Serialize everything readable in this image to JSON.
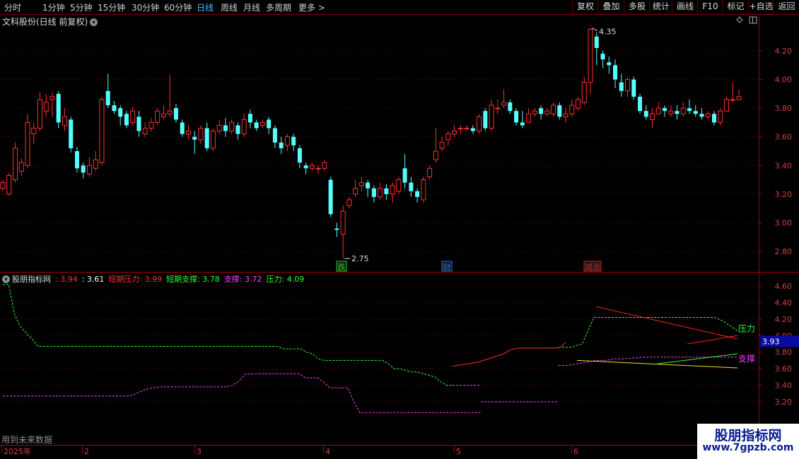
{
  "toolbar": {
    "timeframes": [
      "分时",
      "1分钟",
      "5分钟",
      "15分钟",
      "30分钟",
      "60分钟",
      "日线",
      "周线",
      "月线",
      "多周期",
      "更多 >"
    ],
    "active_timeframe": "日线",
    "buttons": [
      "复权",
      "叠加",
      "多股",
      "统计",
      "画线",
      "F10",
      "标记",
      "+自选",
      "返回"
    ]
  },
  "main_chart": {
    "title": "文科股份(日线 前复权)",
    "high_label": "4.35",
    "low_label": "2.75",
    "price_ticks": [
      "4.20",
      "4.00",
      "3.80",
      "3.60",
      "3.40",
      "3.20",
      "3.00",
      "2.80"
    ],
    "event_markers": [
      {
        "text": "跌",
        "color": "#22cc22"
      },
      {
        "text": "财",
        "color": "#2266ff"
      },
      {
        "text": "涨",
        "color": "#cc2222",
        "prefix": "减"
      }
    ]
  },
  "indicator": {
    "name": "股朋指标网",
    "values": [
      {
        "label": "",
        "value": "3.94",
        "color": "#ff3030"
      },
      {
        "label": "",
        "value": "3.61",
        "color": "#ffffff"
      },
      {
        "label": "短期压力",
        "value": "3.99",
        "color": "#ff3030"
      },
      {
        "label": "短期支撑",
        "value": "3.78",
        "color": "#30ff30"
      },
      {
        "label": "支撑",
        "value": "3.72",
        "color": "#ff40ff"
      },
      {
        "label": "压力",
        "value": "4.09",
        "color": "#30ff30"
      }
    ],
    "ticks": [
      "4.60",
      "4.40",
      "4.20",
      "4.00",
      "3.80",
      "3.60",
      "3.40",
      "3.20"
    ],
    "current_value": "3.93",
    "label_resistance": "压力",
    "label_support": "支撑",
    "footer_note": "用到未来数据"
  },
  "date_axis": [
    "2025年",
    "2",
    "3",
    "4",
    "5",
    "6"
  ],
  "watermark": {
    "line1": "股朋指标网",
    "line2": "www.7gpzb.com"
  },
  "colors": {
    "up": "#ff3030",
    "down": "#54ffff",
    "grid": "#7a0000",
    "axis": "#a00000",
    "resistance": "#30ff30",
    "support": "#ff40ff"
  },
  "chart_data": {
    "type": "candlestick",
    "ylim": [
      2.75,
      4.35
    ],
    "candles": [
      [
        3.24,
        3.28,
        3.3,
        3.22
      ],
      [
        3.2,
        3.33,
        3.35,
        3.19
      ],
      [
        3.3,
        3.52,
        3.56,
        3.28
      ],
      [
        3.36,
        3.42,
        3.45,
        3.33
      ],
      [
        3.4,
        3.7,
        3.76,
        3.38
      ],
      [
        3.62,
        3.66,
        3.7,
        3.55
      ],
      [
        3.66,
        3.86,
        3.91,
        3.64
      ],
      [
        3.78,
        3.84,
        3.9,
        3.74
      ],
      [
        3.86,
        3.88,
        3.91,
        3.74
      ],
      [
        3.9,
        3.7,
        3.92,
        3.66
      ],
      [
        3.68,
        3.74,
        3.8,
        3.64
      ],
      [
        3.72,
        3.52,
        3.74,
        3.49
      ],
      [
        3.5,
        3.38,
        3.53,
        3.35
      ],
      [
        3.4,
        3.35,
        3.42,
        3.31
      ],
      [
        3.34,
        3.4,
        3.46,
        3.32
      ],
      [
        3.38,
        3.44,
        3.5,
        3.36
      ],
      [
        3.42,
        3.86,
        3.88,
        3.4
      ],
      [
        3.92,
        3.82,
        4.04,
        3.8
      ],
      [
        3.82,
        3.78,
        3.85,
        3.76
      ],
      [
        3.8,
        3.74,
        3.82,
        3.68
      ],
      [
        3.76,
        3.68,
        3.78,
        3.66
      ],
      [
        3.7,
        3.78,
        3.81,
        3.68
      ],
      [
        3.74,
        3.64,
        3.78,
        3.6
      ],
      [
        3.62,
        3.66,
        3.7,
        3.6
      ],
      [
        3.66,
        3.7,
        3.73,
        3.64
      ],
      [
        3.7,
        3.78,
        3.8,
        3.68
      ],
      [
        3.74,
        3.76,
        3.82,
        3.72
      ],
      [
        3.76,
        3.78,
        4.03,
        3.74
      ],
      [
        3.8,
        3.72,
        3.83,
        3.7
      ],
      [
        3.7,
        3.62,
        3.72,
        3.6
      ],
      [
        3.62,
        3.64,
        3.68,
        3.58
      ],
      [
        3.6,
        3.58,
        3.64,
        3.48
      ],
      [
        3.58,
        3.66,
        3.68,
        3.55
      ],
      [
        3.66,
        3.52,
        3.7,
        3.5
      ],
      [
        3.52,
        3.64,
        3.66,
        3.5
      ],
      [
        3.64,
        3.68,
        3.72,
        3.62
      ],
      [
        3.68,
        3.64,
        3.73,
        3.6
      ],
      [
        3.64,
        3.7,
        3.72,
        3.62
      ],
      [
        3.68,
        3.62,
        3.7,
        3.58
      ],
      [
        3.62,
        3.72,
        3.76,
        3.6
      ],
      [
        3.76,
        3.7,
        3.79,
        3.66
      ],
      [
        3.7,
        3.66,
        3.72,
        3.64
      ],
      [
        3.68,
        3.7,
        3.72,
        3.66
      ],
      [
        3.72,
        3.66,
        3.74,
        3.62
      ],
      [
        3.66,
        3.56,
        3.68,
        3.52
      ],
      [
        3.56,
        3.52,
        3.6,
        3.48
      ],
      [
        3.54,
        3.6,
        3.62,
        3.5
      ],
      [
        3.6,
        3.54,
        3.62,
        3.5
      ],
      [
        3.52,
        3.42,
        3.54,
        3.38
      ],
      [
        3.4,
        3.38,
        3.42,
        3.34
      ],
      [
        3.38,
        3.4,
        3.42,
        3.36
      ],
      [
        3.38,
        3.38,
        3.4,
        3.34
      ],
      [
        3.38,
        3.42,
        3.44,
        3.36
      ],
      [
        3.3,
        3.06,
        3.32,
        3.04
      ],
      [
        2.96,
        2.95,
        3.0,
        2.9
      ],
      [
        2.92,
        3.08,
        3.12,
        2.75
      ],
      [
        3.12,
        3.16,
        3.18,
        3.1
      ],
      [
        3.2,
        3.24,
        3.3,
        3.18
      ],
      [
        3.26,
        3.28,
        3.32,
        3.22
      ],
      [
        3.28,
        3.24,
        3.3,
        3.18
      ],
      [
        3.24,
        3.18,
        3.26,
        3.14
      ],
      [
        3.18,
        3.24,
        3.28,
        3.16
      ],
      [
        3.24,
        3.2,
        3.27,
        3.16
      ],
      [
        3.2,
        3.26,
        3.28,
        3.14
      ],
      [
        3.22,
        3.3,
        3.32,
        3.2
      ],
      [
        3.38,
        3.28,
        3.48,
        3.24
      ],
      [
        3.28,
        3.22,
        3.32,
        3.18
      ],
      [
        3.22,
        3.18,
        3.24,
        3.14
      ],
      [
        3.16,
        3.3,
        3.32,
        3.14
      ],
      [
        3.32,
        3.38,
        3.4,
        3.3
      ],
      [
        3.44,
        3.5,
        3.66,
        3.42
      ],
      [
        3.52,
        3.56,
        3.6,
        3.5
      ],
      [
        3.58,
        3.62,
        3.64,
        3.54
      ],
      [
        3.62,
        3.64,
        3.68,
        3.6
      ],
      [
        3.66,
        3.66,
        3.68,
        3.62
      ],
      [
        3.66,
        3.66,
        3.68,
        3.64
      ],
      [
        3.66,
        3.64,
        3.68,
        3.62
      ],
      [
        3.64,
        3.74,
        3.76,
        3.62
      ],
      [
        3.78,
        3.66,
        3.8,
        3.64
      ],
      [
        3.66,
        3.82,
        3.86,
        3.64
      ],
      [
        3.8,
        3.8,
        3.86,
        3.76
      ],
      [
        3.82,
        3.84,
        3.93,
        3.8
      ],
      [
        3.84,
        3.78,
        3.86,
        3.76
      ],
      [
        3.78,
        3.7,
        3.8,
        3.68
      ],
      [
        3.7,
        3.68,
        3.78,
        3.66
      ],
      [
        3.7,
        3.76,
        3.8,
        3.7
      ],
      [
        3.76,
        3.78,
        3.8,
        3.74
      ],
      [
        3.8,
        3.76,
        3.82,
        3.72
      ],
      [
        3.76,
        3.78,
        3.8,
        3.74
      ],
      [
        3.76,
        3.82,
        3.84,
        3.74
      ],
      [
        3.82,
        3.74,
        3.84,
        3.72
      ],
      [
        3.74,
        3.76,
        3.8,
        3.7
      ],
      [
        3.76,
        3.82,
        3.86,
        3.74
      ],
      [
        3.8,
        3.86,
        3.88,
        3.78
      ],
      [
        3.84,
        3.98,
        4.02,
        3.82
      ],
      [
        3.98,
        4.35,
        4.36,
        3.9
      ],
      [
        4.3,
        4.22,
        4.33,
        4.1
      ],
      [
        4.18,
        4.14,
        4.2,
        4.08
      ],
      [
        4.12,
        4.1,
        4.16,
        4.04
      ],
      [
        4.1,
        4.0,
        4.14,
        3.94
      ],
      [
        3.98,
        3.92,
        4.04,
        3.88
      ],
      [
        3.92,
        4.0,
        4.02,
        3.88
      ],
      [
        4.0,
        3.88,
        4.02,
        3.86
      ],
      [
        3.88,
        3.78,
        3.9,
        3.76
      ],
      [
        3.78,
        3.74,
        3.82,
        3.72
      ],
      [
        3.72,
        3.76,
        3.8,
        3.66
      ],
      [
        3.76,
        3.8,
        3.84,
        3.76
      ],
      [
        3.8,
        3.78,
        3.82,
        3.74
      ],
      [
        3.76,
        3.78,
        3.82,
        3.74
      ],
      [
        3.78,
        3.76,
        3.82,
        3.72
      ],
      [
        3.76,
        3.8,
        3.84,
        3.74
      ],
      [
        3.8,
        3.78,
        3.86,
        3.76
      ],
      [
        3.78,
        3.76,
        3.82,
        3.74
      ],
      [
        3.76,
        3.74,
        3.8,
        3.72
      ],
      [
        3.74,
        3.76,
        3.78,
        3.72
      ],
      [
        3.76,
        3.7,
        3.78,
        3.68
      ],
      [
        3.7,
        3.78,
        3.8,
        3.68
      ],
      [
        3.78,
        3.86,
        3.88,
        3.78
      ],
      [
        3.86,
        3.86,
        3.98,
        3.84
      ],
      [
        3.86,
        3.88,
        3.93,
        3.86
      ]
    ],
    "indicator_series": {
      "resistance_dashed": [
        4.62,
        4.62,
        4.26,
        4.11,
        4.03,
        3.96,
        3.87,
        3.87,
        3.87,
        3.87,
        3.87,
        3.87,
        3.87,
        3.87,
        3.87,
        3.87,
        3.87,
        3.87,
        3.87,
        3.87,
        3.87,
        3.87,
        3.87,
        3.87,
        3.87,
        3.87,
        3.87,
        3.87,
        3.87,
        3.87,
        3.87,
        3.87,
        3.87,
        3.87,
        3.87,
        3.87,
        3.87,
        3.87,
        3.87,
        3.87,
        3.87,
        3.87,
        3.87,
        3.87,
        3.87,
        3.87,
        3.87,
        3.87,
        3.84,
        3.84,
        3.84,
        3.84,
        3.8,
        3.78,
        3.72,
        3.7,
        3.7,
        3.7,
        3.7,
        3.7,
        3.7,
        3.7,
        3.7,
        3.7,
        3.7,
        3.7,
        3.66,
        3.6,
        3.6,
        3.58,
        3.56,
        3.56,
        3.54,
        3.52,
        3.5,
        3.44,
        3.4,
        3.4
      ],
      "support_dashed": [
        3.27,
        3.27,
        3.27,
        3.27,
        3.27,
        3.27,
        3.27,
        3.27,
        3.27,
        3.27,
        3.27,
        3.27,
        3.27,
        3.27,
        3.27,
        3.27,
        3.27,
        3.27,
        3.27,
        3.27,
        3.27,
        3.27,
        3.3,
        3.33,
        3.36,
        3.37,
        3.38,
        3.38,
        3.38,
        3.38,
        3.38,
        3.38,
        3.38,
        3.38,
        3.38,
        3.38,
        3.38,
        3.38,
        3.4,
        3.45,
        3.53,
        3.54,
        3.54,
        3.54,
        3.54,
        3.54,
        3.54,
        3.54,
        3.54,
        3.54,
        3.49,
        3.49,
        3.49,
        3.44,
        3.37,
        3.37,
        3.37,
        3.37,
        3.2,
        3.07,
        3.07,
        3.07,
        3.07,
        3.07,
        3.07,
        3.07,
        3.07,
        3.07,
        3.07,
        3.07,
        3.07,
        3.07,
        3.07,
        3.07,
        3.07,
        3.07,
        3.07,
        3.07,
        3.07,
        3.07
      ],
      "right_resistance_dashed": [
        4.22,
        4.22,
        4.22,
        4.22,
        4.22,
        4.22,
        4.22,
        4.22,
        4.22,
        4.22,
        4.22,
        4.22,
        4.22,
        4.22,
        4.22,
        4.22,
        4.22,
        4.18,
        4.12,
        4.06
      ],
      "right_support_dashed": [
        3.64,
        3.64,
        3.66,
        3.68,
        3.7,
        3.7,
        3.72,
        3.72,
        3.73,
        3.74,
        3.74,
        3.74,
        3.74,
        3.74,
        3.74,
        3.74,
        3.74,
        3.74,
        3.74,
        3.74
      ],
      "mid_line": [
        3.63,
        3.64,
        3.65,
        3.66,
        3.67,
        3.68,
        3.7,
        3.72,
        3.74,
        3.76,
        3.78,
        3.82,
        3.84,
        3.85,
        3.85,
        3.85,
        3.85,
        3.85,
        3.85,
        3.85,
        3.85,
        3.86,
        3.92
      ],
      "short_resistance": [
        4.35,
        3.96
      ],
      "short_resistance_2": [
        3.9,
        4.0
      ],
      "short_support": [
        3.7,
        3.61
      ],
      "short_support_2": [
        3.66,
        3.78
      ]
    }
  }
}
